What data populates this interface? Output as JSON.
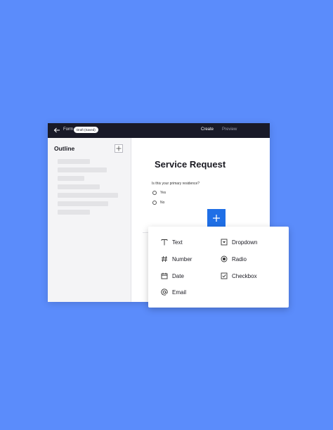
{
  "topbar": {
    "form_label": "Form",
    "status_badge": "Draft (Saved)",
    "tabs": [
      {
        "label": "Create",
        "active": true
      },
      {
        "label": "Preview",
        "active": false
      }
    ]
  },
  "sidebar": {
    "title": "Outline"
  },
  "form": {
    "title": "Service Request",
    "question": "Is this your primary residence?",
    "options": [
      "Yes",
      "No"
    ]
  },
  "field_menu": {
    "items": [
      {
        "label": "Text",
        "icon": "text-icon"
      },
      {
        "label": "Dropdown",
        "icon": "dropdown-icon"
      },
      {
        "label": "Number",
        "icon": "hash-icon"
      },
      {
        "label": "Radio",
        "icon": "radio-icon"
      },
      {
        "label": "Date",
        "icon": "calendar-icon"
      },
      {
        "label": "Checkbox",
        "icon": "checkbox-icon"
      },
      {
        "label": "Email",
        "icon": "at-icon"
      }
    ]
  },
  "colors": {
    "background": "#5b8cfb",
    "topbar": "#191a28",
    "accent": "#1f6fe6"
  }
}
